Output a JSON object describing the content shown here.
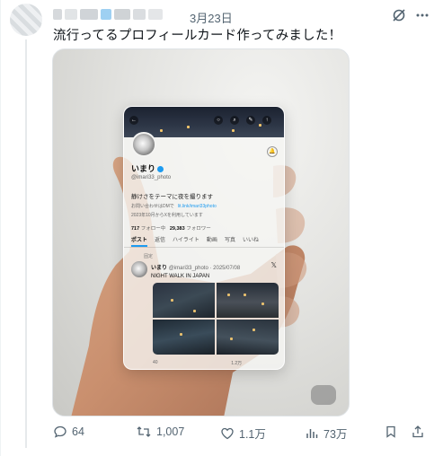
{
  "tweet": {
    "date": "3月23日",
    "text": "流行ってるプロフィールカード作ってみました！",
    "colors": {
      "accent": "#1d9bf0",
      "muted": "#536471"
    }
  },
  "card": {
    "name": "いまり",
    "handle": "@imari33_photo",
    "bio": "静けさをテーマに夜を撮ります",
    "meta_contact": "お問い合わせはDMで",
    "meta_link": "lit.link/imari33photo",
    "meta_joined": "2023年10月からXを利用しています",
    "following_count": "717",
    "following_label": "フォロー中",
    "followers_count": "29,383",
    "followers_label": "フォロワー",
    "tabs": [
      "ポスト",
      "返信",
      "ハイライト",
      "動画",
      "写真",
      "いいね"
    ],
    "pinned_label": "固定",
    "post": {
      "name": "いまり",
      "handle": "@imari33_photo",
      "date": "2025/07/08",
      "text": "NIGHT WALK IN JAPAN",
      "stat1": "40",
      "stat2": "",
      "stat3": "1.2万",
      "stat4": ""
    }
  },
  "actions": {
    "replies": "64",
    "reposts": "1,007",
    "likes": "1.1万",
    "views": "73万"
  }
}
